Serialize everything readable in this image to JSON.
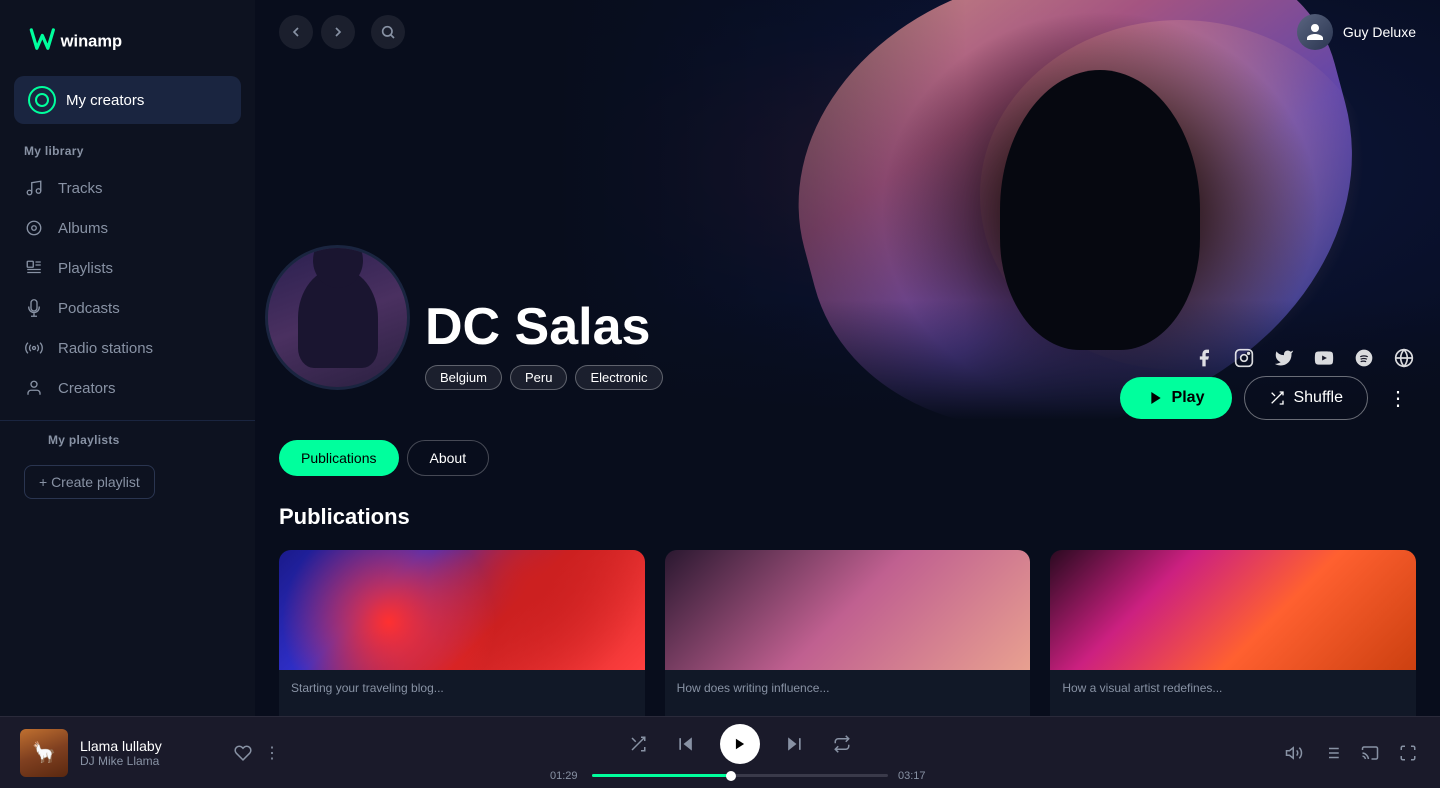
{
  "app": {
    "name": "winamp"
  },
  "sidebar": {
    "my_creators_label": "My creators",
    "library_title": "My library",
    "nav_items": [
      {
        "id": "tracks",
        "label": "Tracks",
        "icon": "music-note"
      },
      {
        "id": "albums",
        "label": "Albums",
        "icon": "disc"
      },
      {
        "id": "playlists",
        "label": "Playlists",
        "icon": "playlist"
      },
      {
        "id": "podcasts",
        "label": "Podcasts",
        "icon": "microphone"
      },
      {
        "id": "radio",
        "label": "Radio stations",
        "icon": "radio"
      },
      {
        "id": "creators",
        "label": "Creators",
        "icon": "person"
      }
    ],
    "playlists_title": "My playlists",
    "create_playlist_label": "+ Create playlist"
  },
  "header": {
    "user_name": "Guy Deluxe"
  },
  "artist": {
    "name": "DC Salas",
    "tags": [
      "Belgium",
      "Peru",
      "Electronic"
    ],
    "social": [
      "facebook",
      "instagram",
      "twitter",
      "youtube",
      "spotify",
      "globe"
    ]
  },
  "tabs": [
    {
      "id": "publications",
      "label": "Publications",
      "active": true
    },
    {
      "id": "about",
      "label": "About",
      "active": false
    }
  ],
  "publications": {
    "title": "Publications",
    "cards": [
      {
        "id": 1,
        "text": "Starting your traveling blog..."
      },
      {
        "id": 2,
        "text": "How does writing influence..."
      },
      {
        "id": 3,
        "text": "How a visual artist redefines..."
      }
    ]
  },
  "action_buttons": {
    "play_label": "Play",
    "shuffle_label": "Shuffle"
  },
  "player": {
    "track_title": "Llama lullaby",
    "track_artist": "DJ Mike Llama",
    "current_time": "01:29",
    "total_time": "03:17",
    "progress_percent": 47
  }
}
